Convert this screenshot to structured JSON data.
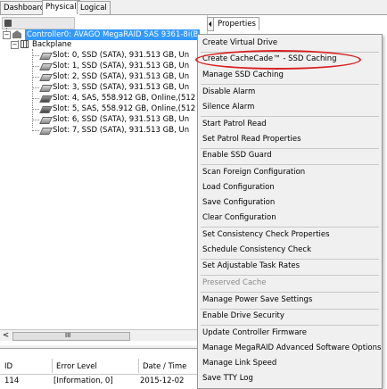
{
  "tabs": [
    "Dashboard",
    "Physical",
    "Logical"
  ],
  "active_tab": "Physical",
  "tree": {
    "controller_label": "Controller0: AVAGO MegaRAID SAS 9361-8i(B",
    "backplane_label": "Backplane",
    "slots": [
      "Slot: 0, SSD (SATA), 931.513 GB, Un",
      "Slot: 1, SSD (SATA), 931.513 GB, Un",
      "Slot: 2, SSD (SATA), 931.513 GB, Un",
      "Slot: 3, SSD (SATA), 931.513 GB, Un",
      "Slot: 4, SAS, 558.912 GB, Online,(512",
      "Slot: 5, SAS, 558.912 GB, Online,(512",
      "Slot: 6, SSD (SATA), 931.513 GB, Un",
      "Slot: 7, SSD (SATA), 931.513 GB, Un"
    ]
  },
  "properties_tab": "Properties",
  "menu": {
    "items": [
      {
        "label": "Create Virtual Drive",
        "disabled": false
      },
      {
        "label": "Create CacheCade™ - SSD Caching",
        "disabled": false
      },
      {
        "label": "Manage SSD Caching",
        "disabled": false
      },
      {
        "label": "Disable Alarm",
        "disabled": false
      },
      {
        "label": "Silence Alarm",
        "disabled": false
      },
      {
        "label": "Start Patrol Read",
        "disabled": false
      },
      {
        "label": "Set Patrol Read Properties",
        "disabled": false
      },
      {
        "label": "Enable SSD Guard",
        "disabled": false
      },
      {
        "label": "Scan Foreign Configuration",
        "disabled": false
      },
      {
        "label": "Load Configuration",
        "disabled": false
      },
      {
        "label": "Save Configuration",
        "disabled": false
      },
      {
        "label": "Clear Configuration",
        "disabled": false
      },
      {
        "label": "Set Consistency Check Properties",
        "disabled": false
      },
      {
        "label": "Schedule Consistency Check",
        "disabled": false
      },
      {
        "label": "Set Adjustable Task Rates",
        "disabled": false
      },
      {
        "label": "Preserved Cache",
        "disabled": true
      },
      {
        "label": "Manage Power Save Settings",
        "disabled": false
      },
      {
        "label": "Enable Drive Security",
        "disabled": false
      },
      {
        "label": "Update Controller Firmware",
        "disabled": false
      },
      {
        "label": "Manage MegaRAID Advanced Software Options",
        "disabled": false
      },
      {
        "label": "Manage Link Speed",
        "disabled": false
      },
      {
        "label": "Save TTY Log",
        "disabled": false
      }
    ]
  },
  "log": {
    "columns": [
      "ID",
      "Error Level",
      "Date / Time"
    ],
    "rows": [
      [
        "114",
        "[Information, 0]",
        "2015-12-02"
      ]
    ]
  },
  "scrollbar": {
    "left_arrow": "<",
    "right_arrow": ">",
    "grip": "III"
  },
  "colors": {
    "selection": "#3399ff",
    "highlight_ring": "#d82020",
    "menu_bg": "#f0f0f0"
  }
}
